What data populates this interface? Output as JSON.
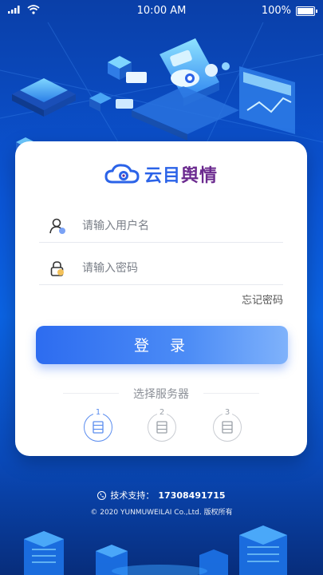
{
  "status_bar": {
    "time": "10:00 AM",
    "battery": "100%",
    "icons": [
      "signal-icon",
      "wifi-icon",
      "battery-icon"
    ]
  },
  "brand": {
    "name_part1": "云目",
    "name_part2": "舆情",
    "colors": {
      "primary": "#2b63e8",
      "secondary": "#6b2a8f"
    }
  },
  "login_form": {
    "username_placeholder": "请输入用户名",
    "password_placeholder": "请输入密码",
    "forgot_password": "忘记密码",
    "submit_label": "登 录"
  },
  "server_select": {
    "title": "选择服务器",
    "servers": [
      {
        "label": "1",
        "selected": true
      },
      {
        "label": "2",
        "selected": false
      },
      {
        "label": "3",
        "selected": false
      }
    ]
  },
  "footer": {
    "support_label": "技术支持：",
    "support_phone": "17308491715",
    "copyright": "© 2020 YUNMUWEILAI Co.,Ltd. 版权所有"
  },
  "colors": {
    "background": "#0b55d6",
    "button_start": "#2d6cf0",
    "button_end": "#7fb2fb"
  }
}
